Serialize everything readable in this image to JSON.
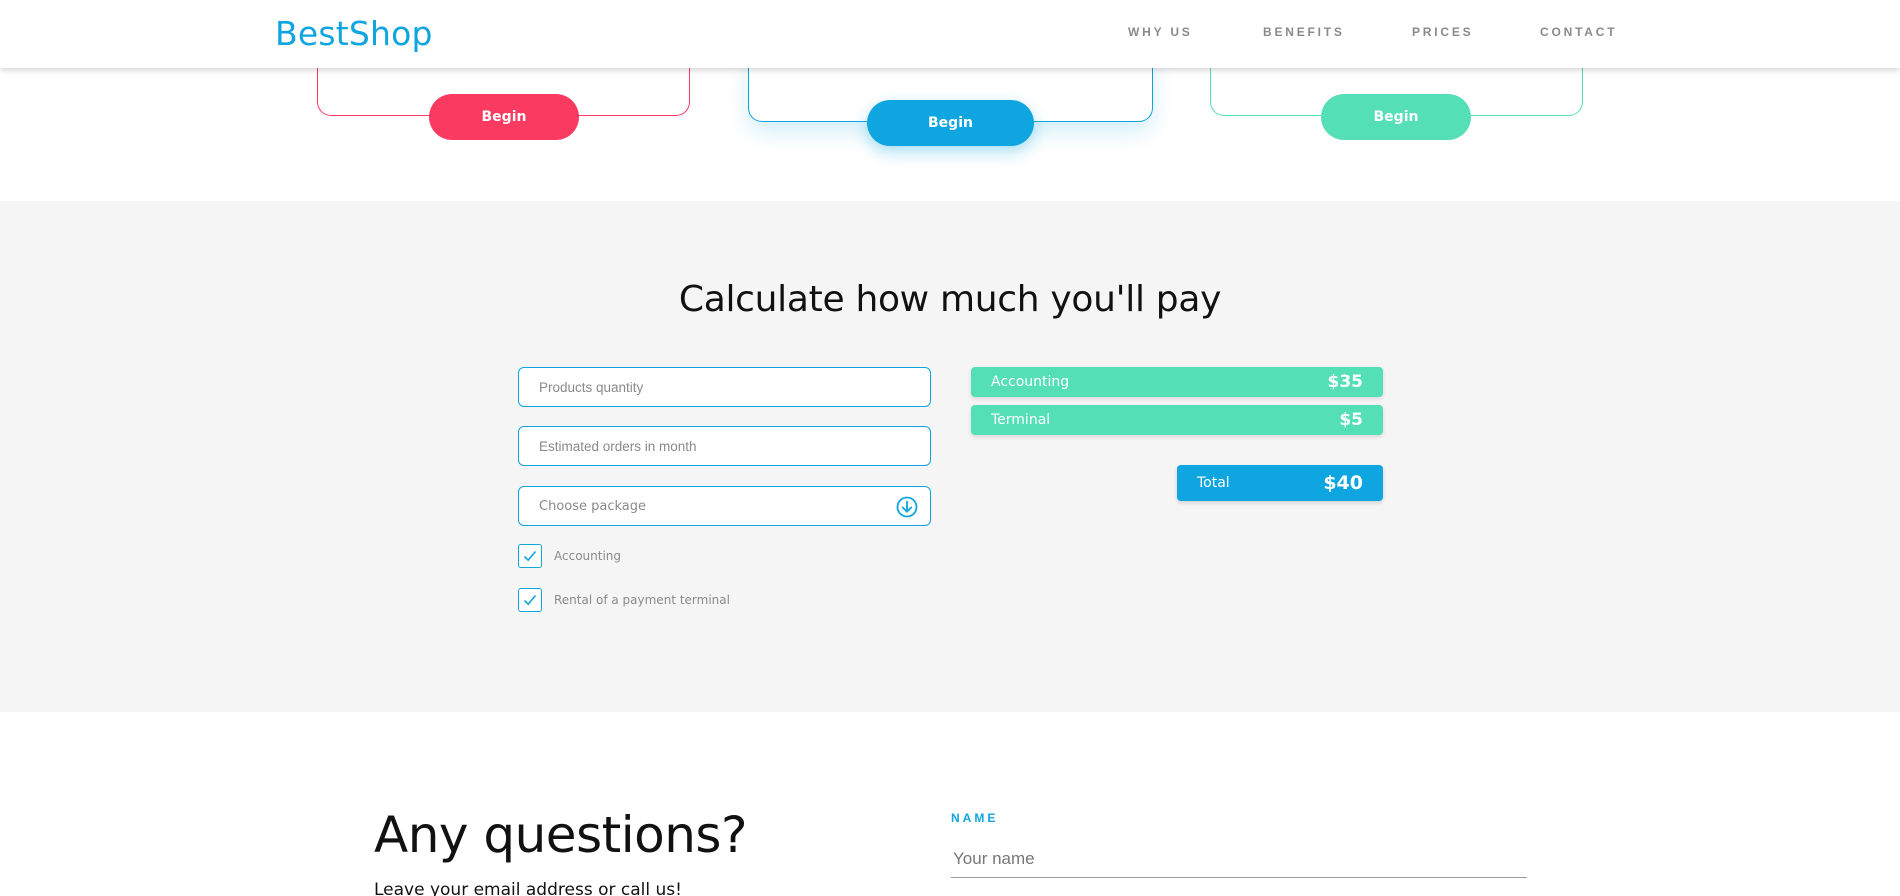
{
  "header": {
    "logo": "BestShop",
    "nav": [
      "WHY US",
      "BENEFITS",
      "PRICES",
      "CONTACT"
    ]
  },
  "pricing": {
    "buttons": [
      "Begin",
      "Begin",
      "Begin"
    ],
    "colors": {
      "red": "#fb3a62",
      "blue": "#0ea5e0",
      "green": "#54dfb6"
    }
  },
  "calculator": {
    "title": "Calculate how much you'll pay",
    "products_placeholder": "Products quantity",
    "orders_placeholder": "Estimated orders in month",
    "package_label": "Choose package",
    "checkboxes": [
      {
        "label": "Accounting",
        "checked": true
      },
      {
        "label": "Rental of a payment terminal",
        "checked": true
      }
    ],
    "summary": [
      {
        "label": "Accounting",
        "value": "$35"
      },
      {
        "label": "Terminal",
        "value": "$5"
      }
    ],
    "total": {
      "label": "Total",
      "value": "$40"
    }
  },
  "contact": {
    "title": "Any questions?",
    "subtitle": "Leave your email address or call us!",
    "name_label": "NAME",
    "name_placeholder": "Your name"
  }
}
